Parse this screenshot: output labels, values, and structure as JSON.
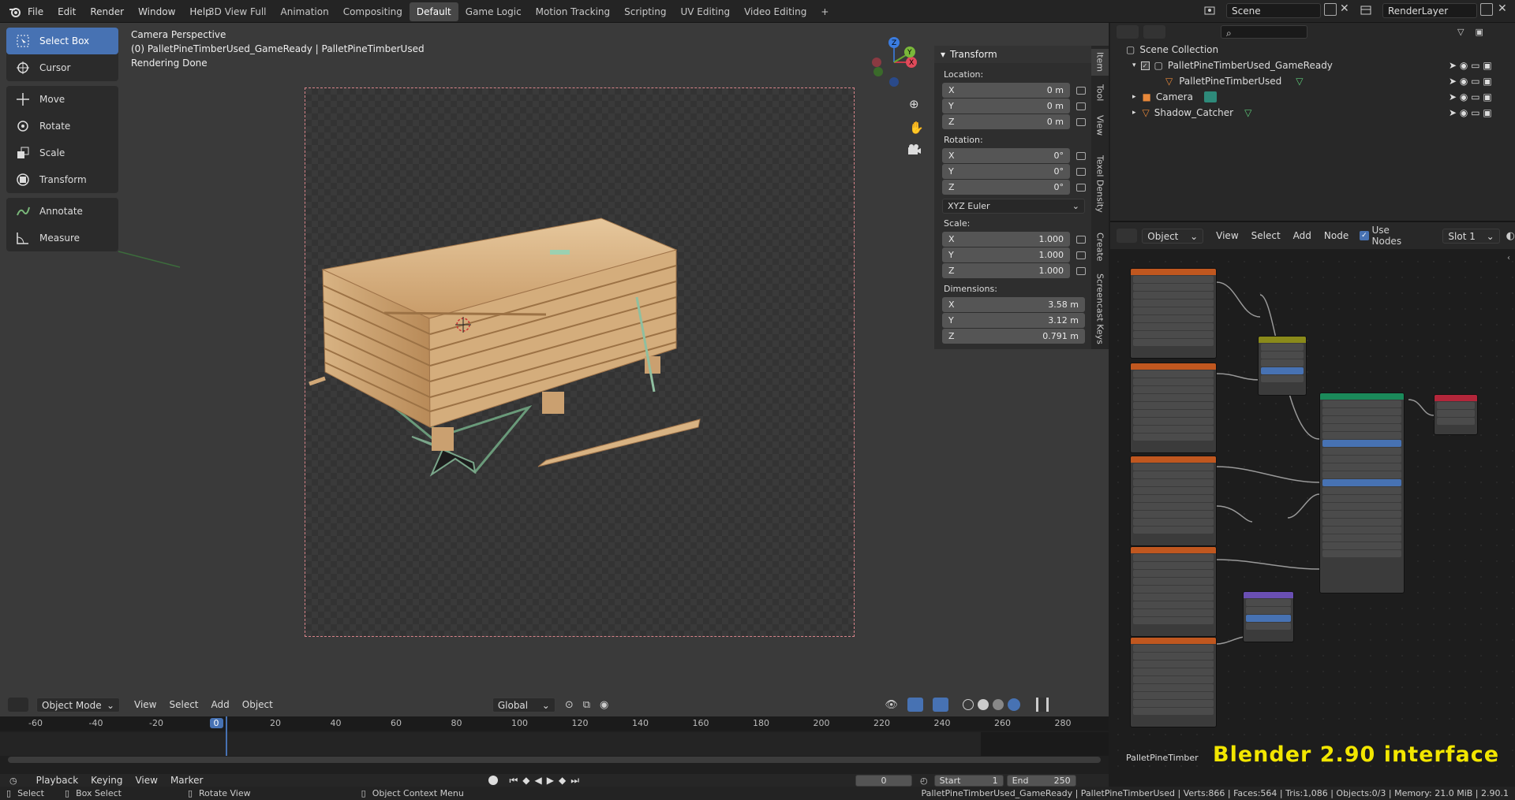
{
  "menu": [
    "File",
    "Edit",
    "Render",
    "Window",
    "Help"
  ],
  "workspaces": [
    "3D View Full",
    "Animation",
    "Compositing",
    "Default",
    "Game Logic",
    "Motion Tracking",
    "Scripting",
    "UV Editing",
    "Video Editing"
  ],
  "active_workspace": "Default",
  "scene": "Scene",
  "render_layer": "RenderLayer",
  "viewport": {
    "info": [
      "Camera Perspective",
      "(0) PalletPineTimberUsed_GameReady | PalletPineTimberUsed",
      "Rendering Done"
    ]
  },
  "tools": [
    "Select Box",
    "Cursor",
    "Move",
    "Rotate",
    "Scale",
    "Transform",
    "Annotate",
    "Measure"
  ],
  "npanel": {
    "title": "Transform",
    "location_label": "Location:",
    "location": [
      {
        "axis": "X",
        "value": "0 m"
      },
      {
        "axis": "Y",
        "value": "0 m"
      },
      {
        "axis": "Z",
        "value": "0 m"
      }
    ],
    "rotation_label": "Rotation:",
    "rotation": [
      {
        "axis": "X",
        "value": "0°"
      },
      {
        "axis": "Y",
        "value": "0°"
      },
      {
        "axis": "Z",
        "value": "0°"
      }
    ],
    "rotation_mode": "XYZ Euler",
    "scale_label": "Scale:",
    "scale": [
      {
        "axis": "X",
        "value": "1.000"
      },
      {
        "axis": "Y",
        "value": "1.000"
      },
      {
        "axis": "Z",
        "value": "1.000"
      }
    ],
    "dimensions_label": "Dimensions:",
    "dimensions": [
      {
        "axis": "X",
        "value": "3.58 m"
      },
      {
        "axis": "Y",
        "value": "3.12 m"
      },
      {
        "axis": "Z",
        "value": "0.791 m"
      }
    ]
  },
  "side_tabs": [
    "Item",
    "Tool",
    "View",
    "Texel Density",
    "Create",
    "Screencast Keys"
  ],
  "outliner": {
    "root": "Scene Collection",
    "items": [
      "PalletPineTimberUsed_GameReady",
      "PalletPineTimberUsed",
      "Camera",
      "Shadow_Catcher"
    ]
  },
  "node_header": {
    "mode": "Object",
    "menus": [
      "View",
      "Select",
      "Add",
      "Node"
    ],
    "use_nodes": "Use Nodes",
    "slot": "Slot 1"
  },
  "node_footer": "PalletPineTimber",
  "watermark": "Blender 2.90 interface",
  "viewport_header": {
    "mode": "Object Mode",
    "menus": [
      "View",
      "Select",
      "Add",
      "Object"
    ],
    "orientation": "Global"
  },
  "timeline": {
    "ticks": [
      "-60",
      "-40",
      "-20",
      "0",
      "20",
      "40",
      "60",
      "80",
      "100",
      "120",
      "140",
      "160",
      "180",
      "200",
      "220",
      "240",
      "260",
      "280"
    ],
    "current_frame": "0",
    "start_label": "Start",
    "start": "1",
    "end_label": "End",
    "end": "250",
    "menus": [
      "Playback",
      "Keying",
      "View",
      "Marker"
    ]
  },
  "status": {
    "select": "Select",
    "box_select": "Box Select",
    "rotate_view": "Rotate View",
    "context_menu": "Object Context Menu",
    "info": "PalletPineTimberUsed_GameReady | PalletPineTimberUsed | Verts:866 | Faces:564 | Tris:1,086 | Objects:0/3 | Memory: 21.0 MiB | 2.90.1"
  }
}
